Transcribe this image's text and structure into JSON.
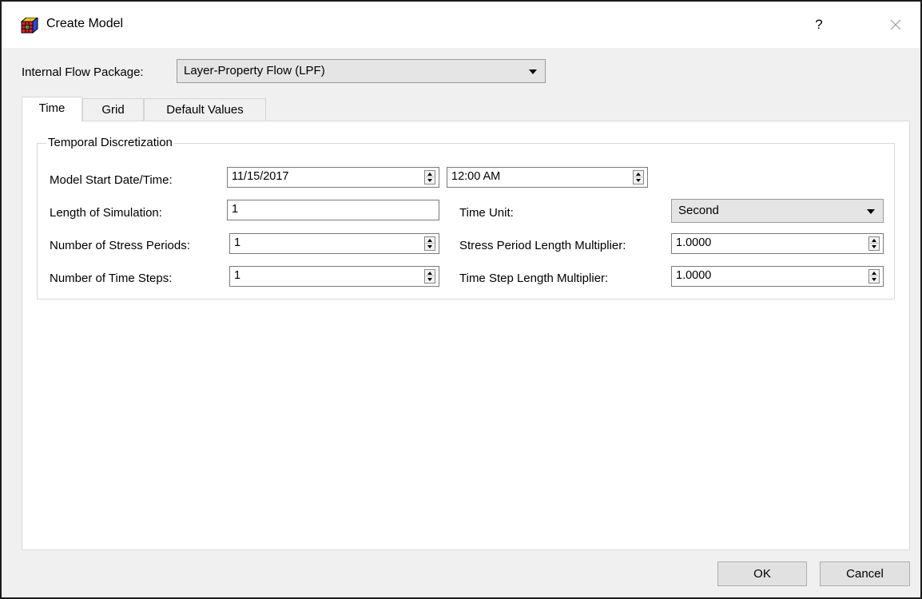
{
  "window": {
    "title": "Create Model",
    "help_label": "?",
    "close_label": "✕"
  },
  "flow_package": {
    "label": "Internal Flow Package:",
    "value": "Layer-Property Flow (LPF)"
  },
  "tabs": [
    {
      "label": "Time",
      "active": true
    },
    {
      "label": "Grid",
      "active": false
    },
    {
      "label": "Default Values",
      "active": false
    }
  ],
  "temporal": {
    "group_title": "Temporal Discretization",
    "start_label": "Model Start Date/Time:",
    "start_date": "11/15/2017",
    "start_time": "12:00 AM",
    "length_label": "Length of Simulation:",
    "length_value": "1",
    "time_unit_label": "Time Unit:",
    "time_unit_value": "Second",
    "stress_periods_label": "Number of Stress Periods:",
    "stress_periods_value": "1",
    "sp_multiplier_label": "Stress Period Length Multiplier:",
    "sp_multiplier_value": "1.0000",
    "time_steps_label": "Number of Time Steps:",
    "time_steps_value": "1",
    "ts_multiplier_label": "Time Step Length Multiplier:",
    "ts_multiplier_value": "1.0000"
  },
  "buttons": {
    "ok": "OK",
    "cancel": "Cancel"
  },
  "colors": {
    "dialog_bg": "#f0f0f0",
    "panel_bg": "#ffffff",
    "combo_bg": "#e5e5e5",
    "button_bg": "#e1e1e1"
  }
}
